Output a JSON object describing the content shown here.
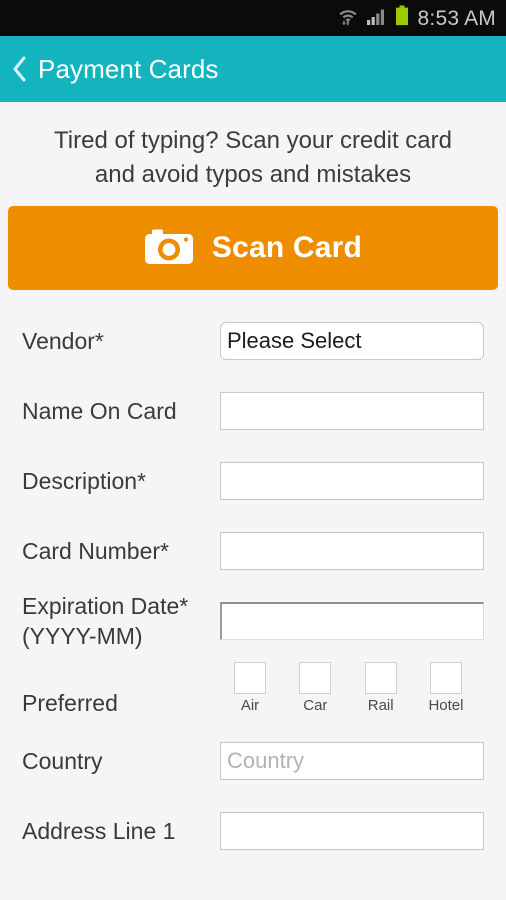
{
  "status_bar": {
    "time": "8:53 AM",
    "icons": [
      "wifi-icon",
      "cellular-signal-icon",
      "battery-icon"
    ],
    "battery_color": "#9ccc00",
    "background": "#0b0b0b",
    "text_color": "#c9c9c9"
  },
  "header": {
    "back_label": "❮",
    "title": "Payment Cards",
    "background": "#14b4bf",
    "text_color": "#ffffff"
  },
  "promo": {
    "line1": "Tired of typing? Scan your credit card",
    "line2": "and avoid typos and mistakes"
  },
  "scan_button": {
    "label": "Scan Card",
    "icon": "camera-icon",
    "background": "#ef8d00",
    "text_color": "#ffffff"
  },
  "form": {
    "required_marker": "*",
    "fields": [
      {
        "name": "vendor",
        "label": "Vendor",
        "required": true,
        "type": "select",
        "value": "Please Select",
        "placeholder": ""
      },
      {
        "name": "name-on-card",
        "label": "Name On Card",
        "required": false,
        "type": "text",
        "value": "",
        "placeholder": ""
      },
      {
        "name": "description",
        "label": "Description",
        "required": true,
        "type": "text",
        "value": "",
        "placeholder": ""
      },
      {
        "name": "card-number",
        "label": "Card Number",
        "required": true,
        "type": "text",
        "value": "",
        "placeholder": ""
      },
      {
        "name": "expiration-date",
        "label": "Expiration Date",
        "label_line2": "(YYYY-MM)",
        "required": true,
        "type": "date",
        "value": "",
        "placeholder": ""
      },
      {
        "name": "preferred",
        "label": "Preferred",
        "required": false,
        "type": "checkbox-group",
        "options": [
          {
            "label": "Air",
            "checked": false
          },
          {
            "label": "Car",
            "checked": false
          },
          {
            "label": "Rail",
            "checked": false
          },
          {
            "label": "Hotel",
            "checked": false
          }
        ]
      },
      {
        "name": "country",
        "label": "Country",
        "required": false,
        "type": "text",
        "value": "",
        "placeholder": "Country"
      },
      {
        "name": "address-line-1",
        "label": "Address Line 1",
        "required": false,
        "type": "text",
        "value": "",
        "placeholder": ""
      }
    ]
  },
  "theme": {
    "page_background": "#f5f5f5",
    "accent_teal": "#14b4bf",
    "accent_orange": "#ef8d00",
    "label_color": "#3a3a3a",
    "input_border": "#c8c8c8",
    "placeholder_color": "#b2b2b2"
  }
}
